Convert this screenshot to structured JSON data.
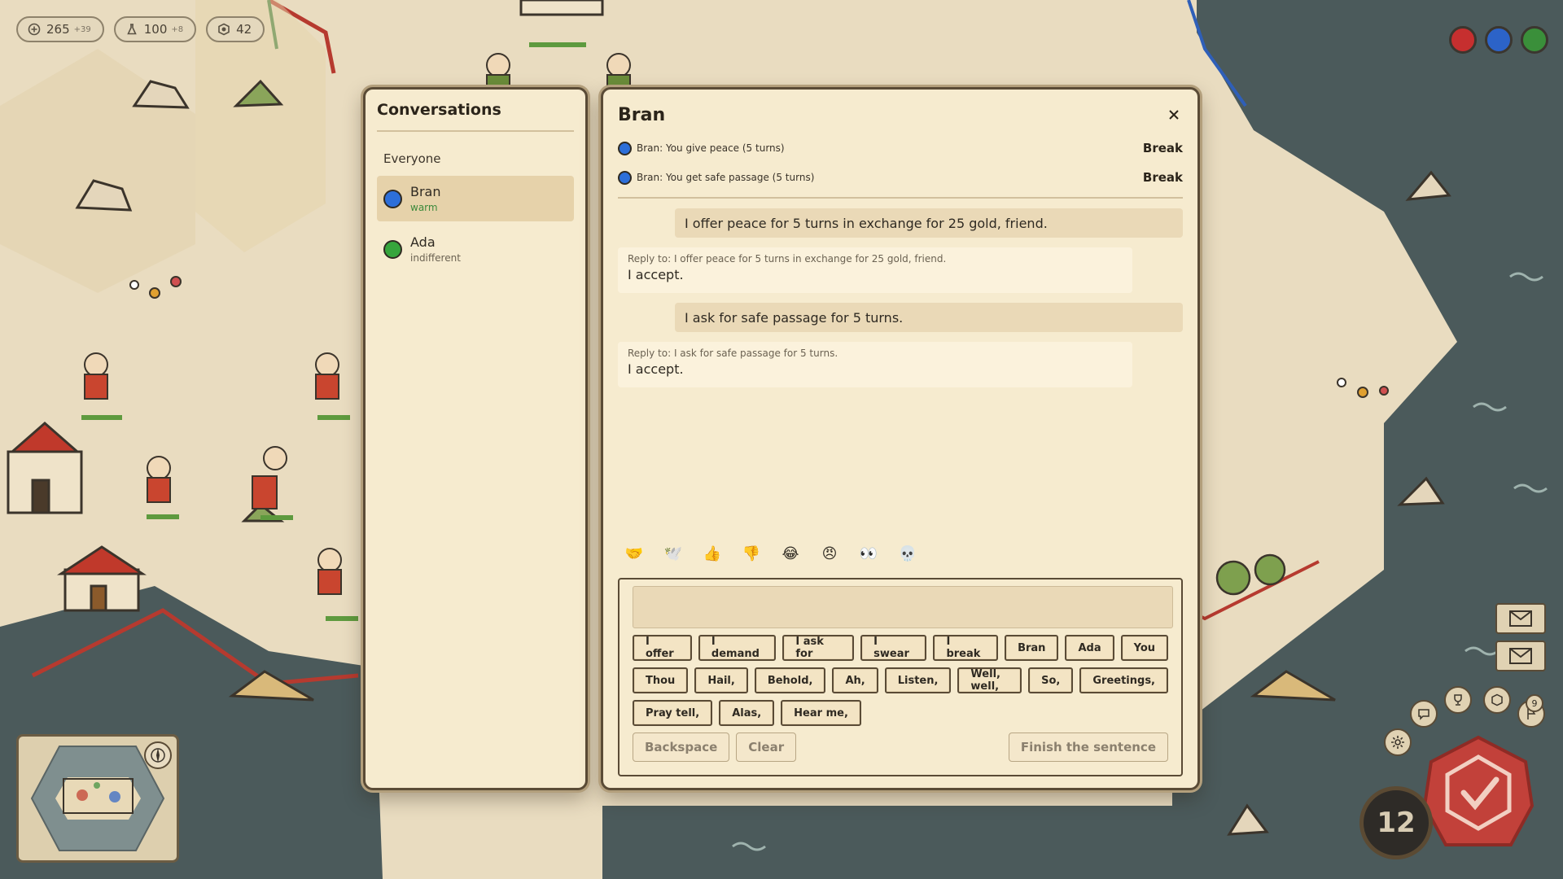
{
  "resources": [
    {
      "icon": "coin-icon",
      "value": "265",
      "delta": "+39"
    },
    {
      "icon": "flask-icon",
      "value": "100",
      "delta": "+8"
    },
    {
      "icon": "shield-icon",
      "value": "42",
      "delta": ""
    }
  ],
  "players": [
    {
      "color": "#c62f2f"
    },
    {
      "color": "#2c63c8"
    },
    {
      "color": "#3a8f3a"
    }
  ],
  "conversations": {
    "title": "Conversations",
    "everyone": "Everyone",
    "items": [
      {
        "name": "Bran",
        "mood": "warm",
        "color": "#2d6fd9",
        "mood_color": "#3c8a3c",
        "active": true
      },
      {
        "name": "Ada",
        "mood": "indifferent",
        "color": "#36a53c",
        "mood_color": "#6b6252",
        "active": false
      }
    ]
  },
  "chat": {
    "title": "Bran",
    "treaties": [
      {
        "text": "Bran: You give peace (5 turns)",
        "action": "Break",
        "color": "#2d6fd9"
      },
      {
        "text": "Bran: You get safe passage (5 turns)",
        "action": "Break",
        "color": "#2d6fd9"
      }
    ],
    "messages": [
      {
        "type": "out",
        "text": "I offer peace for 5 turns in exchange for 25 gold, friend."
      },
      {
        "type": "in",
        "reply": "Reply to: I offer peace for 5 turns in exchange for 25 gold, friend.",
        "text": "I accept."
      },
      {
        "type": "out",
        "text": "I ask for safe passage for 5 turns."
      },
      {
        "type": "in",
        "reply": "Reply to: I ask for safe passage for 5 turns.",
        "text": "I accept."
      }
    ],
    "emojis": [
      {
        "glyph": "🤝",
        "name": "handshake-emoji"
      },
      {
        "glyph": "🕊️",
        "name": "dove-emoji"
      },
      {
        "glyph": "👍",
        "name": "thumbs-up-emoji"
      },
      {
        "glyph": "👎",
        "name": "thumbs-down-emoji"
      },
      {
        "glyph": "😂",
        "name": "laughing-emoji"
      },
      {
        "glyph": "😠",
        "name": "angry-emoji"
      },
      {
        "glyph": "👀",
        "name": "eyes-emoji"
      },
      {
        "glyph": "💀",
        "name": "skull-emoji"
      }
    ],
    "composer_value": "",
    "word_rows": [
      [
        "I offer",
        "I demand",
        "I ask for",
        "I swear",
        "I break",
        "Bran",
        "Ada",
        "You"
      ],
      [
        "Thou",
        "Hail,",
        "Behold,",
        "Ah,",
        "Listen,",
        "Well, well,",
        "So,",
        "Greetings,"
      ],
      [
        "Pray tell,",
        "Alas,",
        "Hear me,"
      ]
    ],
    "actions": {
      "backspace": "Backspace",
      "clear": "Clear",
      "finish": "Finish the sentence"
    }
  },
  "hud": {
    "turn": "12",
    "notification_count": "9",
    "colors": {
      "panel": "#f6ebcf",
      "border": "#5a4b36",
      "sea": "#4a5a5c",
      "land": "#e9dcc0",
      "end_turn": "#c2413a"
    }
  }
}
